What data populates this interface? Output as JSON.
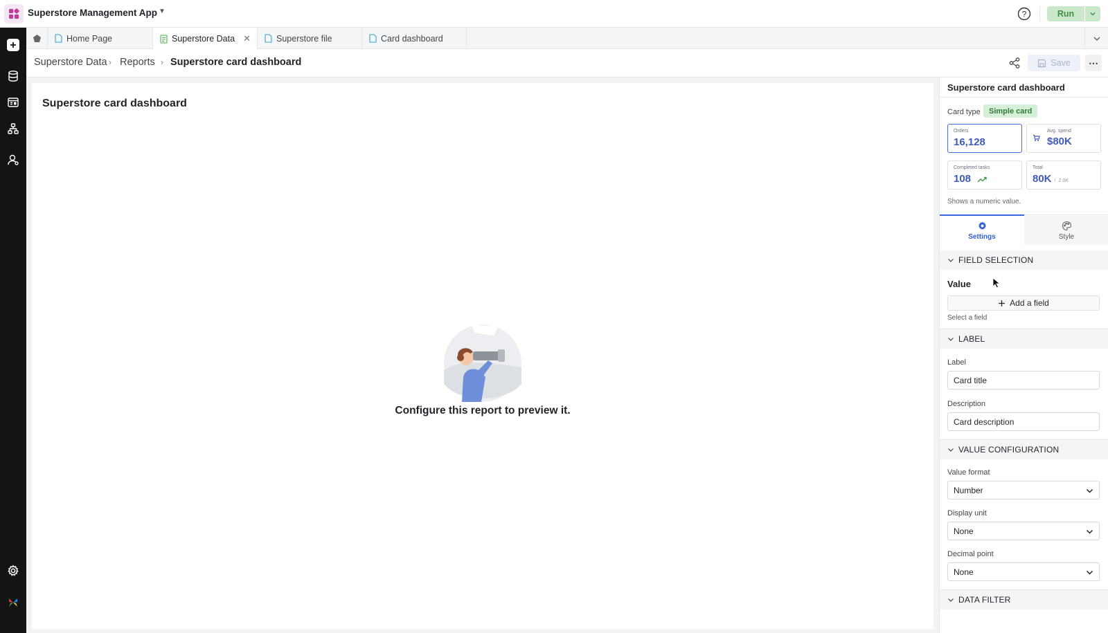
{
  "app": {
    "name": "Superstore Management App",
    "run_label": "Run"
  },
  "tabs": [
    {
      "label": "Home Page"
    },
    {
      "label": "Superstore Data"
    },
    {
      "label": "Superstore file"
    },
    {
      "label": "Card dashboard"
    }
  ],
  "breadcrumb": {
    "items": [
      "Superstore Data",
      "Reports",
      "Superstore card dashboard"
    ],
    "save_label": "Save"
  },
  "canvas": {
    "title": "Superstore card dashboard",
    "empty_message": "Configure this report to preview it."
  },
  "panel": {
    "title": "Superstore card dashboard",
    "card_type_label": "Card type",
    "card_type_value": "Simple card",
    "preview_cards": [
      {
        "title": "Orders",
        "value": "16,128"
      },
      {
        "title": "Avg. spend",
        "value": "$80K"
      },
      {
        "title": "Completed tasks",
        "value": "108"
      },
      {
        "title": "Total",
        "value": "80K",
        "secondary": "2.0K"
      }
    ],
    "shows_note": "Shows a numeric value.",
    "tabs": {
      "settings": "Settings",
      "style": "Style"
    },
    "sections": {
      "field_selection": "FIELD SELECTION",
      "label": "LABEL",
      "value_configuration": "VALUE CONFIGURATION",
      "data_filter": "DATA FILTER"
    },
    "value_heading": "Value",
    "add_field_label": "Add a field",
    "select_hint": "Select a field",
    "label_field": {
      "label": "Label",
      "value": "Card title"
    },
    "description_field": {
      "label": "Description",
      "value": "Card description"
    },
    "value_format": {
      "label": "Value format",
      "value": "Number"
    },
    "display_unit": {
      "label": "Display unit",
      "value": "None"
    },
    "decimal_point": {
      "label": "Decimal point",
      "value": "None"
    }
  },
  "colors": {
    "accent": "#3a66db",
    "run_bg": "#cbe8cc",
    "rail_bg": "#141414",
    "badge_bg": "#d6efd8"
  }
}
